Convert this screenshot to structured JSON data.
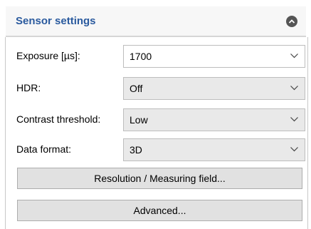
{
  "panel": {
    "title": "Sensor settings",
    "collapse_icon": "chevron-up-circle-icon"
  },
  "fields": [
    {
      "label": "Exposure [µs]:",
      "value": "1700"
    },
    {
      "label": "HDR:",
      "value": "Off"
    },
    {
      "label": "Contrast threshold:",
      "value": "Low"
    },
    {
      "label": "Data format:",
      "value": "3D"
    }
  ],
  "buttons": {
    "resolution": "Resolution / Measuring field...",
    "advanced": "Advanced..."
  },
  "colors": {
    "title": "#2a5a9e",
    "header_bg": "#f7f7f7",
    "button_bg": "#e1e1e1",
    "select_disabled_bg": "#e9e9e9"
  }
}
